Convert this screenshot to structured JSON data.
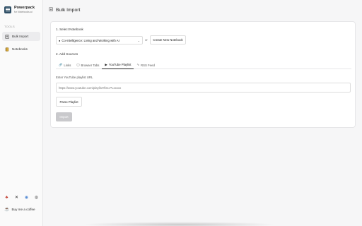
{
  "sidebar": {
    "brand_name": "Powerpack",
    "brand_sub": "for Notebooks.ai",
    "tools_label": "TOOLS",
    "items": [
      {
        "label": "Bulk Import",
        "icon": "upload-icon",
        "active": true
      },
      {
        "label": "Notebooks",
        "icon": "notebook-icon",
        "active": false
      }
    ],
    "footer_icons": [
      "github-icon",
      "x-icon",
      "globe-icon",
      "eye-icon"
    ],
    "coffee_label": "Buy me a coffee"
  },
  "header": {
    "title": "Bulk Import",
    "icon": "import-icon"
  },
  "form": {
    "step1_label": "1. Select Notebook",
    "notebook_value": "Co-Intelligence: Living and Working with AI",
    "or_text": "or",
    "create_label": "Create New Notebook",
    "step2_label": "2. Add Sources",
    "tabs": [
      {
        "label": "Links",
        "icon": "link-icon",
        "active": false
      },
      {
        "label": "Browser Tabs",
        "icon": "browser-tab-icon",
        "active": false
      },
      {
        "label": "YouTube Playlist",
        "icon": "youtube-icon",
        "active": true
      },
      {
        "label": "RSS Feed",
        "icon": "rss-icon",
        "active": false
      }
    ],
    "field_label": "Enter YouTube playlist URL",
    "url_placeholder": "https://www.youtube.com/playlist?list=PLxxxxx",
    "parse_label": "Parse Playlist",
    "import_label": "Import"
  }
}
